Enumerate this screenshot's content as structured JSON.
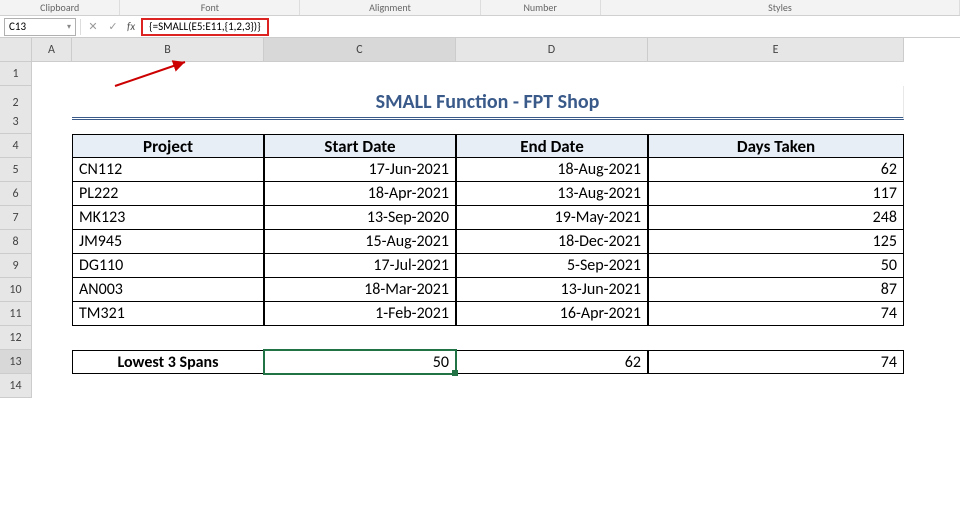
{
  "ribbon": {
    "groups": [
      "Clipboard",
      "Font",
      "Alignment",
      "Number",
      "Styles"
    ]
  },
  "namebox": "C13",
  "formula": "{=SMALL(E5:E11,{1,2,3})}",
  "cols": [
    "A",
    "B",
    "C",
    "D",
    "E"
  ],
  "rows": [
    "1",
    "2",
    "3",
    "4",
    "5",
    "6",
    "7",
    "8",
    "9",
    "10",
    "11",
    "12",
    "13",
    "14"
  ],
  "title": "SMALL Function - FPT Shop",
  "headers": {
    "b": "Project",
    "c": "Start Date",
    "d": "End Date",
    "e": "Days Taken"
  },
  "data": [
    {
      "b": "CN112",
      "c": "17-Jun-2021",
      "d": "18-Aug-2021",
      "e": "62"
    },
    {
      "b": "PL222",
      "c": "18-Apr-2021",
      "d": "13-Aug-2021",
      "e": "117"
    },
    {
      "b": "MK123",
      "c": "13-Sep-2020",
      "d": "19-May-2021",
      "e": "248"
    },
    {
      "b": "JM945",
      "c": "15-Aug-2021",
      "d": "18-Dec-2021",
      "e": "125"
    },
    {
      "b": "DG110",
      "c": "17-Jul-2021",
      "d": "5-Sep-2021",
      "e": "50"
    },
    {
      "b": "AN003",
      "c": "18-Mar-2021",
      "d": "13-Jun-2021",
      "e": "87"
    },
    {
      "b": "TM321",
      "c": "1-Feb-2021",
      "d": "16-Apr-2021",
      "e": "74"
    }
  ],
  "result_label": "Lowest 3 Spans",
  "results": {
    "c": "50",
    "d": "62",
    "e": "74"
  },
  "chart_data": {
    "type": "table",
    "title": "SMALL Function - FPT Shop",
    "columns": [
      "Project",
      "Start Date",
      "End Date",
      "Days Taken"
    ],
    "rows": [
      [
        "CN112",
        "17-Jun-2021",
        "18-Aug-2021",
        62
      ],
      [
        "PL222",
        "18-Apr-2021",
        "13-Aug-2021",
        117
      ],
      [
        "MK123",
        "13-Sep-2020",
        "19-May-2021",
        248
      ],
      [
        "JM945",
        "15-Aug-2021",
        "18-Dec-2021",
        125
      ],
      [
        "DG110",
        "17-Jul-2021",
        "5-Sep-2021",
        50
      ],
      [
        "AN003",
        "18-Mar-2021",
        "13-Jun-2021",
        87
      ],
      [
        "TM321",
        "1-Feb-2021",
        "16-Apr-2021",
        74
      ]
    ],
    "summary": {
      "label": "Lowest 3 Spans",
      "values": [
        50,
        62,
        74
      ]
    }
  }
}
